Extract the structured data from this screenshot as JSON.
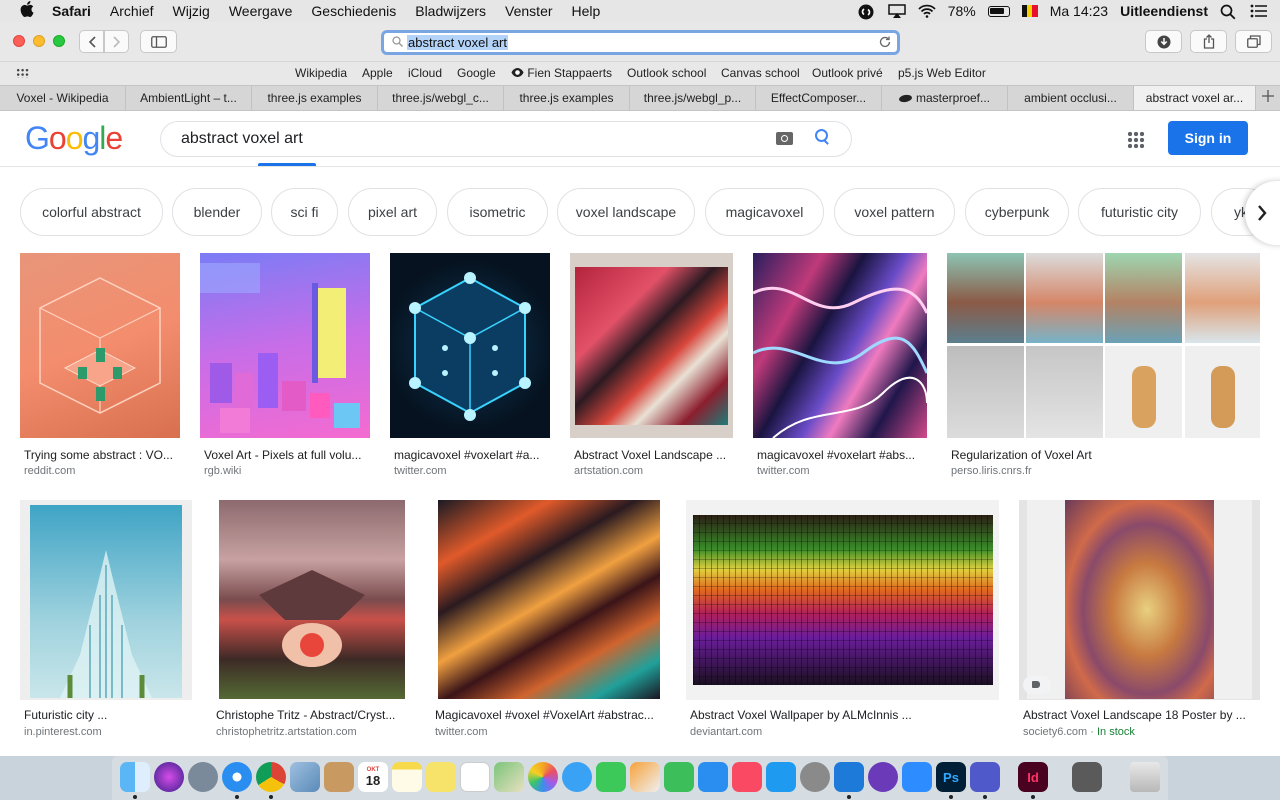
{
  "menubar": {
    "app": "Safari",
    "items": [
      "Archief",
      "Wijzig",
      "Weergave",
      "Geschiedenis",
      "Bladwijzers",
      "Venster",
      "Help"
    ],
    "battery": "78%",
    "datetime": "Ma 14:23",
    "user": "Uitleendienst"
  },
  "addressbar": {
    "value": "abstract voxel art"
  },
  "favorites": [
    "Wikipedia",
    "Apple",
    "iCloud",
    "Google",
    "Fien Stappaerts",
    "Outlook school",
    "Canvas school",
    "Outlook privé",
    "p5.js Web Editor"
  ],
  "tabs": [
    "Voxel - Wikipedia",
    "AmbientLight – t...",
    "three.js examples",
    "three.js/webgl_c...",
    "three.js examples",
    "three.js/webgl_p...",
    "EffectComposer...",
    "masterproef...",
    "ambient occlusi...",
    "abstract voxel ar..."
  ],
  "google": {
    "logo": "Google",
    "query": "abstract voxel art",
    "sign_in": "Sign in"
  },
  "chips": [
    "colorful abstract",
    "blender",
    "sci fi",
    "pixel art",
    "isometric",
    "voxel landscape",
    "magicavoxel",
    "voxel pattern",
    "cyberpunk",
    "futuristic city",
    "yk"
  ],
  "results": [
    {
      "title": "Trying some abstract : VO...",
      "source": "reddit.com"
    },
    {
      "title": "Voxel Art - Pixels at full volu...",
      "source": "rgb.wiki"
    },
    {
      "title": "magicavoxel #voxelart #a...",
      "source": "twitter.com"
    },
    {
      "title": "Abstract Voxel Landscape ...",
      "source": "artstation.com"
    },
    {
      "title": "magicavoxel #voxelart #abs...",
      "source": "twitter.com"
    },
    {
      "title": "Regularization of Voxel Art",
      "source": "perso.liris.cnrs.fr"
    },
    {
      "title": "Futuristic city ...",
      "source": "in.pinterest.com"
    },
    {
      "title": "Christophe Tritz - Abstract/Cryst...",
      "source": "christophetritz.artstation.com"
    },
    {
      "title": "Magicavoxel #voxel #VoxelArt #abstrac...",
      "source": "twitter.com"
    },
    {
      "title": "Abstract Voxel Wallpaper by ALMcInnis ...",
      "source": "deviantart.com"
    },
    {
      "title": "Abstract Voxel Landscape 18 Poster by ...",
      "source": "society6.com",
      "stock": "In stock"
    }
  ],
  "dock": {
    "icons": [
      "finder-icon",
      "siri-icon",
      "launchpad-icon",
      "safari-icon",
      "chrome-icon",
      "preview-icon",
      "contacts-icon",
      "calendar-icon",
      "notes-icon",
      "stickies-icon",
      "reminders-icon",
      "maps-icon",
      "photos-icon",
      "messages-icon",
      "facetime-icon",
      "pages-icon",
      "numbers-icon",
      "keynote-icon",
      "music-icon",
      "app-store-icon",
      "system-preferences-icon",
      "vscode-icon",
      "github-desktop-icon",
      "zoom-icon",
      "photoshop-icon",
      "teams-icon",
      "indesign-icon",
      "screen-icon",
      "trash-icon"
    ],
    "calendar_month": "OKT",
    "calendar_day": "18",
    "photoshop_label": "Ps",
    "indesign_label": "Id"
  }
}
